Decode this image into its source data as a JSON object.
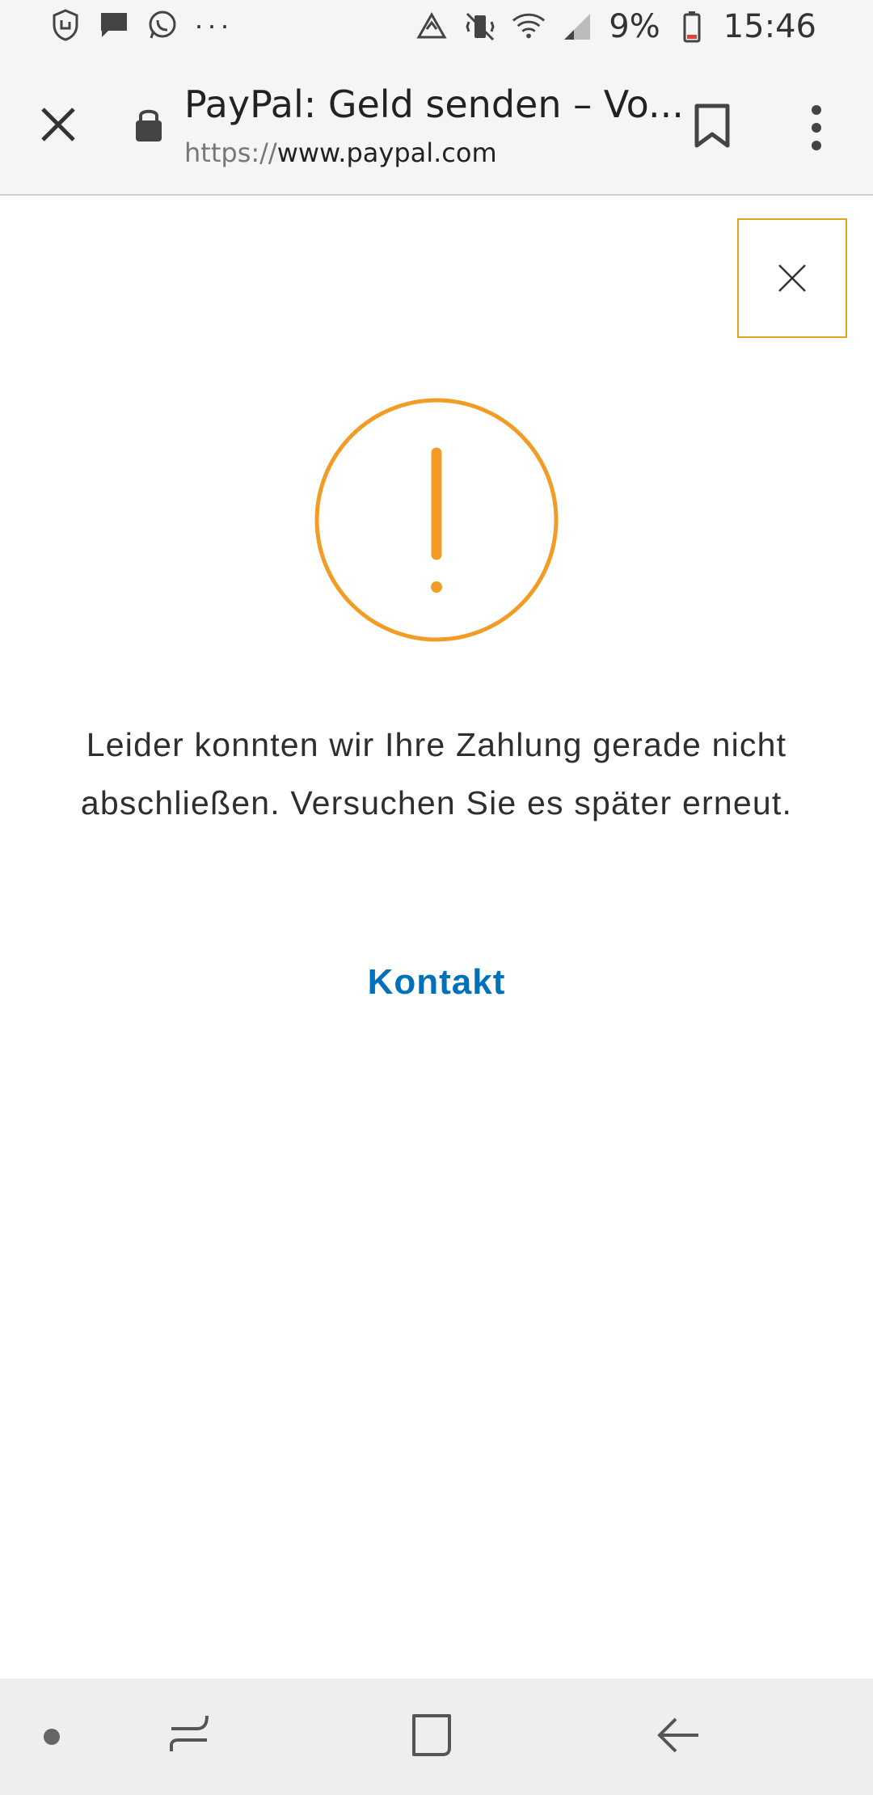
{
  "status_bar": {
    "left_icons": [
      "shield-hand-icon",
      "message-icon",
      "whatsapp-icon"
    ],
    "overflow": "···",
    "right_icons": [
      "sync-icon",
      "vibrate-mute-icon",
      "wifi-icon",
      "signal-icon"
    ],
    "battery": "9%",
    "time": "15:46"
  },
  "toolbar": {
    "title": "PayPal: Geld senden – Vo...",
    "url_scheme": "https://",
    "url_host": "www.paypal.com"
  },
  "dialog": {
    "message": "Leider konnten wir Ihre Zahlung gerade nicht abschließen. Versuchen Sie es später erneut.",
    "contact_link": "Kontakt",
    "accent_color": "#f29c26",
    "link_color": "#0070ba"
  }
}
